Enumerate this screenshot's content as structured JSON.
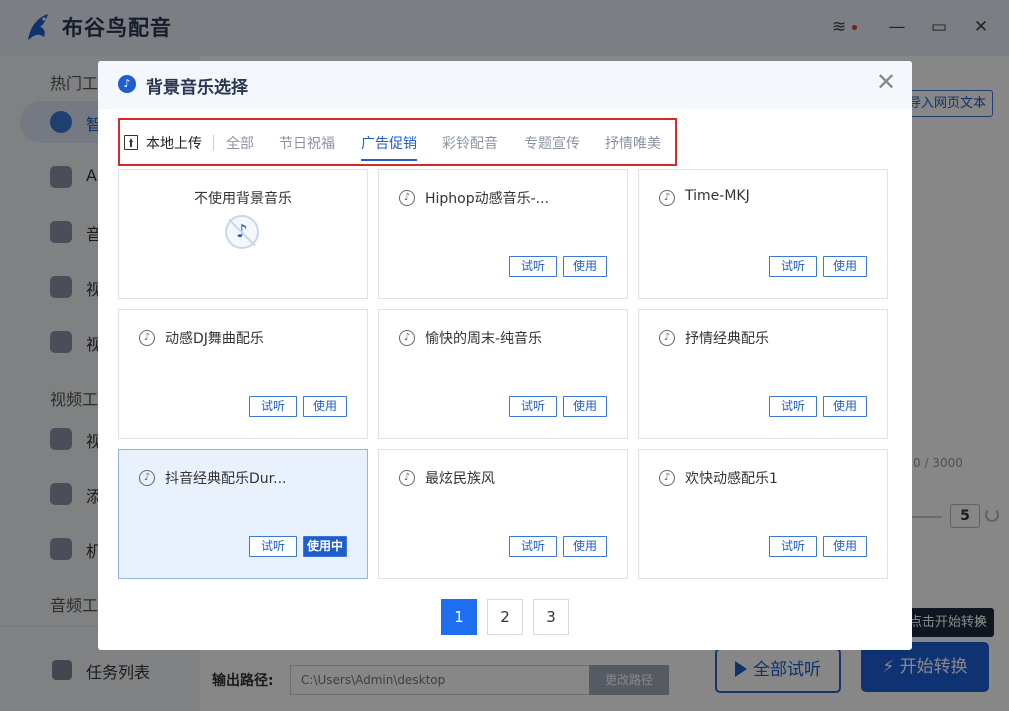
{
  "app": {
    "title": "布谷鸟配音",
    "sidebar": {
      "sections": [
        "热门工",
        "视频工",
        "音频工"
      ],
      "items": [
        "智",
        "A",
        "音",
        "视",
        "视",
        "视",
        "添",
        "机"
      ],
      "task_list": "任务列表"
    },
    "import_web_text": "导入网页文本",
    "counter": "0 / 3000",
    "stepper_value": "5",
    "tooltip": "点击开始转换",
    "output": {
      "label": "输出路径:",
      "path": "C:\\Users\\Admin\\desktop",
      "change_button": "更改路径"
    },
    "listen_all_button": "全部试听",
    "start_convert_button": "开始转换"
  },
  "dialog": {
    "title": "背景音乐选择",
    "close_glyph": "✕",
    "upload_label": "本地上传",
    "tabs": [
      {
        "label": "全部",
        "active": false
      },
      {
        "label": "节日祝福",
        "active": false
      },
      {
        "label": "广告促销",
        "active": true
      },
      {
        "label": "彩铃配音",
        "active": false
      },
      {
        "label": "专题宣传",
        "active": false
      },
      {
        "label": "抒情唯美",
        "active": false
      }
    ],
    "cards": [
      {
        "name": "不使用背景音乐"
      },
      {
        "name": "Hiphop动感音乐-...",
        "listen": "试听",
        "use": "使用"
      },
      {
        "name": "Time-MKJ",
        "listen": "试听",
        "use": "使用"
      },
      {
        "name": "动感DJ舞曲配乐",
        "listen": "试听",
        "use": "使用"
      },
      {
        "name": "愉快的周末-纯音乐",
        "listen": "试听",
        "use": "使用"
      },
      {
        "name": "抒情经典配乐",
        "listen": "试听",
        "use": "使用"
      },
      {
        "name": "抖音经典配乐Dur...",
        "listen": "试听",
        "use": "使用中",
        "selected": true
      },
      {
        "name": "最炫民族风",
        "listen": "试听",
        "use": "使用"
      },
      {
        "name": "欢快动感配乐1",
        "listen": "试听",
        "use": "使用"
      }
    ],
    "pagination": [
      "1",
      "2",
      "3"
    ],
    "current_page": "1"
  },
  "colors": {
    "accent": "#1e5fcc",
    "highlight_box": "#d42a2a",
    "selected_card_bg": "#e9f1fd",
    "overlay": "rgba(0,0,0,0.47)"
  },
  "icons": {
    "app_logo": "bird-logo-icon",
    "dialog": "music-note-icon",
    "upload": "upload-icon",
    "card": "music-note-icon",
    "none": "no-music-icon"
  }
}
